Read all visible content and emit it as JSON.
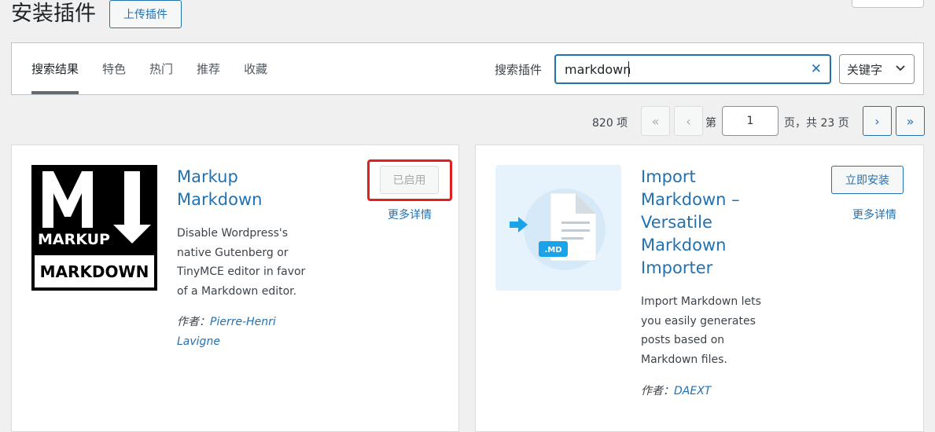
{
  "page": {
    "title": "安装插件",
    "upload_label": "上传插件"
  },
  "filter": {
    "tabs": [
      "搜索结果",
      "特色",
      "热门",
      "推荐",
      "收藏"
    ],
    "active_tab": "搜索结果",
    "search_label": "搜索插件",
    "search_value": "markdown",
    "search_type": "关键字"
  },
  "pagination": {
    "count": "820 项",
    "first": "«",
    "prev": "‹",
    "page_prefix": "第",
    "current_page": "1",
    "page_suffix": "页，共 23 页",
    "next": "›",
    "last": "»"
  },
  "plugins": [
    {
      "title_line1": "Markup",
      "title_line2": "Markdown",
      "desc": [
        "Disable Wordpress's",
        "native Gutenberg or",
        "TinyMCE editor in favor",
        "of a Markdown editor."
      ],
      "author_prefix": "作者：",
      "author_line1": "Pierre-Henri",
      "author_line2": "Lavigne",
      "action_label": "已启用",
      "more_label": "更多详情",
      "icon": {
        "top_text": "MARKUP",
        "bottom_text": "MARKDOWN",
        "brand_mark": "M"
      }
    },
    {
      "title_lines": [
        "Import",
        "Markdown –",
        "Versatile",
        "Markdown",
        "Importer"
      ],
      "desc": [
        "Import Markdown lets",
        "you easily generates",
        "posts based on",
        "Markdown files."
      ],
      "author_prefix": "作者：",
      "author": "DAEXT",
      "action_label": "立即安装",
      "more_label": "更多详情",
      "icon": {
        "badge": ".MD"
      }
    }
  ],
  "colors": {
    "accent": "#2271b1",
    "highlight": "#e02020",
    "background": "#f0f0f1"
  }
}
